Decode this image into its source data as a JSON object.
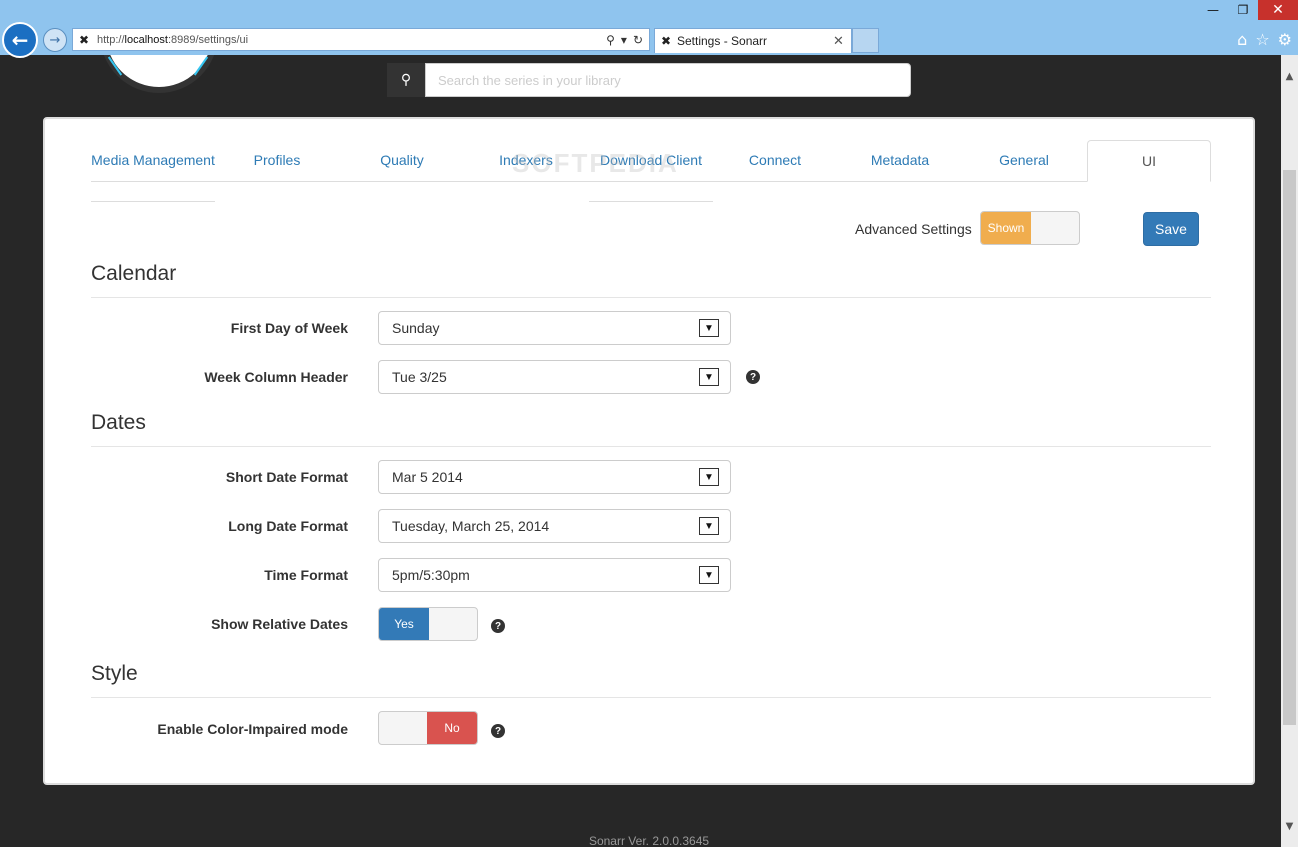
{
  "browser": {
    "url_prefix": "http://",
    "url_host": "localhost",
    "url_path": ":8989/settings/ui",
    "tab_title": "Settings - Sonarr",
    "window_controls": {
      "minimize": "—",
      "restore": "❐",
      "close": "✕"
    }
  },
  "header": {
    "search_placeholder": "Search the series in your library"
  },
  "settings_tabs": [
    {
      "label": "Media Management"
    },
    {
      "label": "Profiles"
    },
    {
      "label": "Quality"
    },
    {
      "label": "Indexers"
    },
    {
      "label": "Download Client"
    },
    {
      "label": "Connect"
    },
    {
      "label": "Metadata"
    },
    {
      "label": "General"
    },
    {
      "label": "UI"
    }
  ],
  "toolbar": {
    "advanced_label": "Advanced Settings",
    "advanced_toggle": "Shown",
    "save_label": "Save"
  },
  "calendar": {
    "legend": "Calendar",
    "first_day_label": "First Day of Week",
    "first_day_value": "Sunday",
    "week_header_label": "Week Column Header",
    "week_header_value": "Tue 3/25"
  },
  "dates": {
    "legend": "Dates",
    "short_label": "Short Date Format",
    "short_value": "Mar 5 2014",
    "long_label": "Long Date Format",
    "long_value": "Tuesday, March 25, 2014",
    "time_label": "Time Format",
    "time_value": "5pm/5:30pm",
    "relative_label": "Show Relative Dates",
    "relative_toggle": "Yes"
  },
  "style": {
    "legend": "Style",
    "color_impaired_label": "Enable Color-Impaired mode",
    "color_impaired_toggle": "No"
  },
  "footer": {
    "version": "Sonarr Ver. 2.0.0.3645"
  },
  "watermark": "SOFTPEDIA",
  "colors": {
    "accent": "#337ab7",
    "warning": "#f0ad4e",
    "danger": "#d9534f",
    "background": "#272727"
  }
}
